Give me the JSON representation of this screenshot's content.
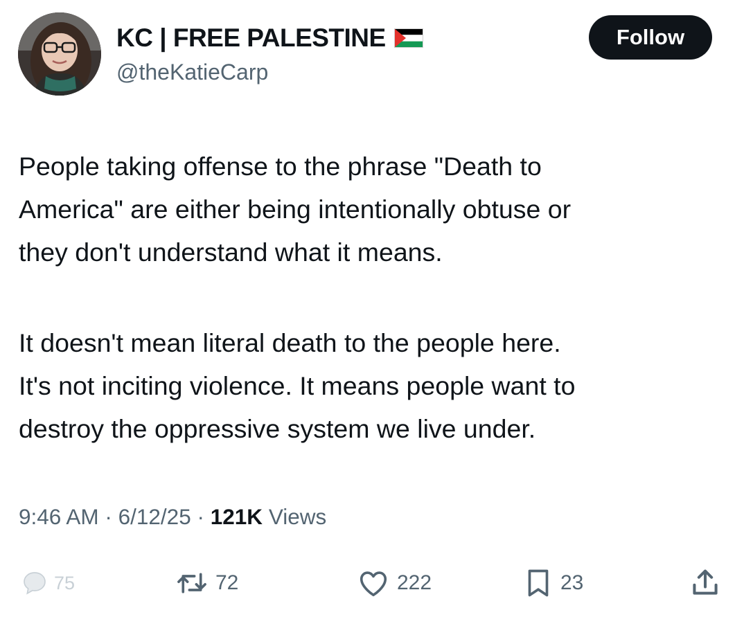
{
  "author": {
    "display_name": "KC | FREE PALESTINE",
    "flag_icon": "palestine-flag-icon",
    "handle": "@theKatieCarp"
  },
  "follow_label": "Follow",
  "tweet": {
    "paragraphs": [
      {
        "lines": [
          "People taking offense to the phrase \"Death to",
          "America\" are either being intentionally obtuse or",
          "they don't understand what it means."
        ]
      },
      {
        "lines": [
          "It doesn't mean literal death to the people here.",
          "It's not inciting violence. It means people want to",
          "destroy the oppressive system we live under."
        ]
      }
    ]
  },
  "meta": {
    "time": "9:46 AM",
    "separator": "·",
    "date": "6/12/25",
    "views_count": "121K",
    "views_label": "Views"
  },
  "actions": {
    "replies": "75",
    "reposts": "72",
    "likes": "222",
    "bookmarks": "23"
  },
  "colors": {
    "text": "#0f1419",
    "secondary": "#536471",
    "follow_bg": "#0f1419",
    "flag_red": "#e4312b",
    "flag_green": "#149954"
  }
}
